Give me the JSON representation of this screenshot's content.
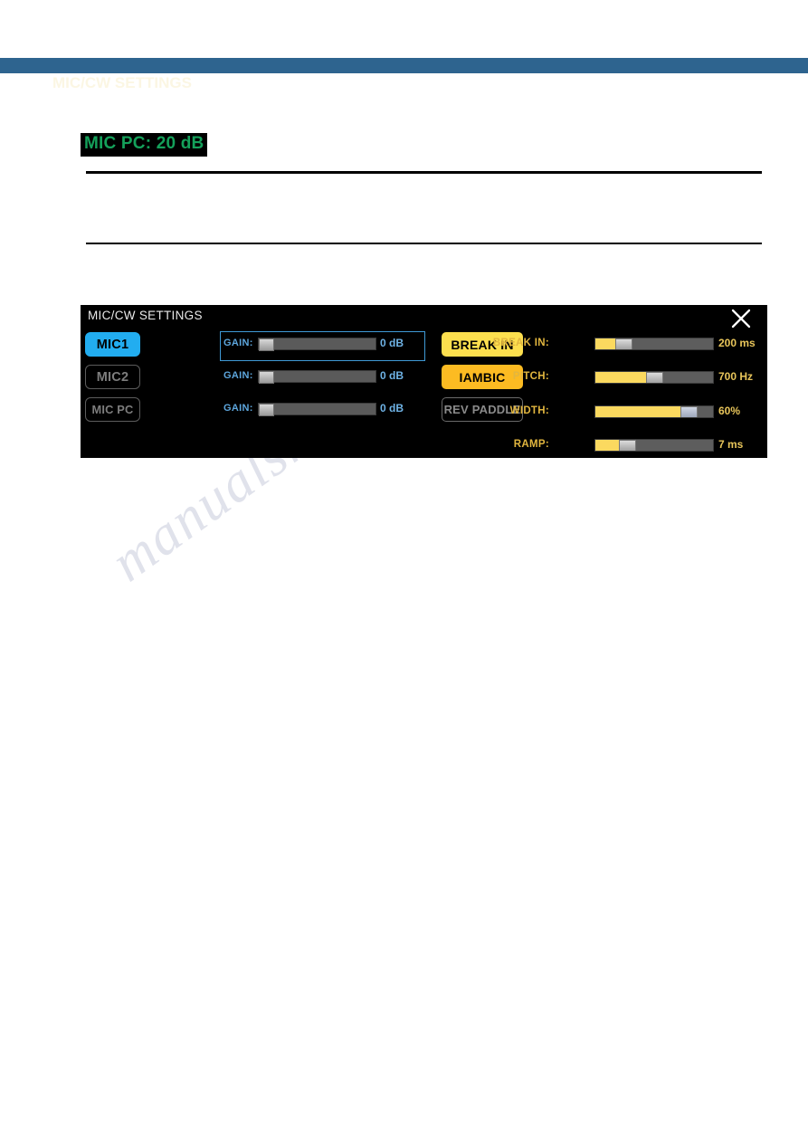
{
  "page": {
    "header_ghost_text": "MIC/CW SETTINGS",
    "caption": "MIC PC: 20 dB"
  },
  "colors": {
    "band": "#2e648f",
    "panel_bg": "#000000",
    "active_mic": "#22adf0",
    "break_in_yellow": "#fcdf4e",
    "iambic_amber": "#fcbb22",
    "slider_fill": "#fbd95f",
    "gain_value_blue": "#6fb3e6",
    "cw_label_gold": "#e2b63f",
    "caption_green": "#14a05a"
  },
  "watermark": {
    "text": "manualshive.com"
  },
  "panel": {
    "title": "MIC/CW SETTINGS",
    "close_icon": "close-icon",
    "mic_rows": [
      {
        "button_label": "MIC1",
        "state": "active",
        "gain_label": "GAIN:",
        "gain_value": "0 dB",
        "gain_percent": 0,
        "focused": true
      },
      {
        "button_label": "MIC2",
        "state": "inactive",
        "gain_label": "GAIN:",
        "gain_value": "0 dB",
        "gain_percent": 0,
        "focused": false
      },
      {
        "button_label": "MIC PC",
        "state": "inactive",
        "gain_label": "GAIN:",
        "gain_value": "0 dB",
        "gain_percent": 0,
        "focused": false
      }
    ],
    "cw_buttons": [
      {
        "label": "BREAK IN",
        "state": "active"
      },
      {
        "label": "IAMBIC",
        "state": "active"
      },
      {
        "label": "REV PADDLE",
        "state": "inactive"
      }
    ],
    "cw_sliders": [
      {
        "label": "BREAK IN:",
        "value": "200 ms",
        "percent": 17,
        "thumb": "gray"
      },
      {
        "label": "PITCH:",
        "value": "700 Hz",
        "percent": 43,
        "thumb": "gray"
      },
      {
        "label": "WIDTH:",
        "value": "60%",
        "percent": 72,
        "thumb": "bluish"
      },
      {
        "label": "RAMP:",
        "value": "7 ms",
        "percent": 20,
        "thumb": "gray"
      }
    ]
  }
}
